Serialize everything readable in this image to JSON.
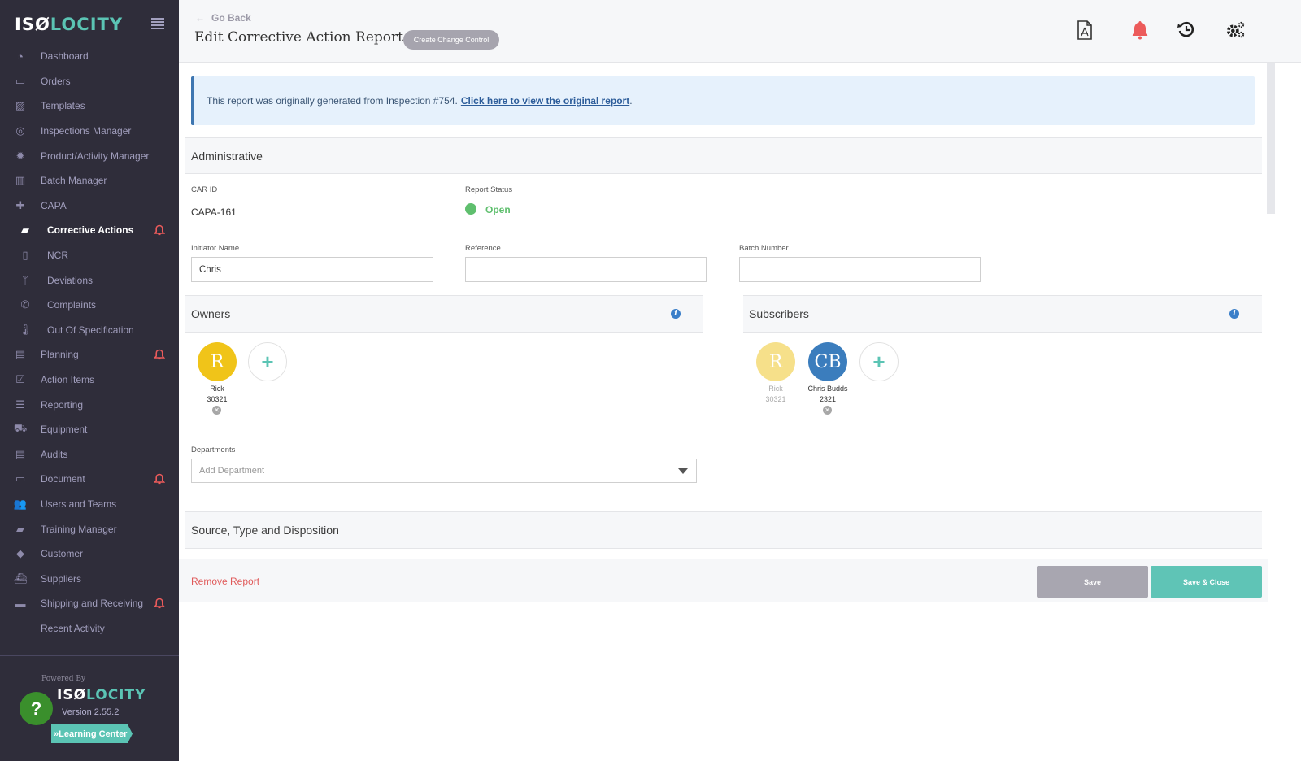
{
  "sidebar": {
    "logo_white": "ISØ",
    "logo_teal": "LOCITY",
    "items": [
      {
        "label": "Dashboard",
        "icon": "dashboard-icon",
        "glyph": "◔",
        "sub": false,
        "active": false,
        "bell": false
      },
      {
        "label": "Orders",
        "icon": "inbox-icon",
        "glyph": "▭",
        "sub": false,
        "active": false,
        "bell": false
      },
      {
        "label": "Templates",
        "icon": "image-icon",
        "glyph": "▨",
        "sub": false,
        "active": false,
        "bell": false
      },
      {
        "label": "Inspections Manager",
        "icon": "target-icon",
        "glyph": "◎",
        "sub": false,
        "active": false,
        "bell": false
      },
      {
        "label": "Product/Activity Manager",
        "icon": "gear-icon",
        "glyph": "✹",
        "sub": false,
        "active": false,
        "bell": false
      },
      {
        "label": "Batch Manager",
        "icon": "barcode-icon",
        "glyph": "▥",
        "sub": false,
        "active": false,
        "bell": false
      },
      {
        "label": "CAPA",
        "icon": "medkit-icon",
        "glyph": "✚",
        "sub": false,
        "active": false,
        "bell": false
      },
      {
        "label": "Corrective Actions",
        "icon": "book-icon",
        "glyph": "▰",
        "sub": true,
        "active": true,
        "bell": true
      },
      {
        "label": "NCR",
        "icon": "file-icon",
        "glyph": "▯",
        "sub": true,
        "active": false,
        "bell": false
      },
      {
        "label": "Deviations",
        "icon": "branch-icon",
        "glyph": "ᛘ",
        "sub": true,
        "active": false,
        "bell": false
      },
      {
        "label": "Complaints",
        "icon": "phone-icon",
        "glyph": "✆",
        "sub": true,
        "active": false,
        "bell": false
      },
      {
        "label": "Out Of Specification",
        "icon": "thermometer-icon",
        "glyph": "🌡",
        "sub": true,
        "active": false,
        "bell": false
      },
      {
        "label": "Planning",
        "icon": "map-icon",
        "glyph": "▤",
        "sub": false,
        "active": false,
        "bell": true
      },
      {
        "label": "Action Items",
        "icon": "checkbox-icon",
        "glyph": "☑",
        "sub": false,
        "active": false,
        "bell": false
      },
      {
        "label": "Reporting",
        "icon": "report-icon",
        "glyph": "☰",
        "sub": false,
        "active": false,
        "bell": false
      },
      {
        "label": "Equipment",
        "icon": "truck-icon",
        "glyph": "⛟",
        "sub": false,
        "active": false,
        "bell": false
      },
      {
        "label": "Audits",
        "icon": "document-icon",
        "glyph": "▤",
        "sub": false,
        "active": false,
        "bell": false
      },
      {
        "label": "Document",
        "icon": "folder-icon",
        "glyph": "▭",
        "sub": false,
        "active": false,
        "bell": true
      },
      {
        "label": "Users and Teams",
        "icon": "users-icon",
        "glyph": "👥",
        "sub": false,
        "active": false,
        "bell": false
      },
      {
        "label": "Training Manager",
        "icon": "book-icon",
        "glyph": "▰",
        "sub": false,
        "active": false,
        "bell": false
      },
      {
        "label": "Customer",
        "icon": "tag-icon",
        "glyph": "◆",
        "sub": false,
        "active": false,
        "bell": false
      },
      {
        "label": "Suppliers",
        "icon": "ship-icon",
        "glyph": "⛴",
        "sub": false,
        "active": false,
        "bell": false
      },
      {
        "label": "Shipping and Receiving",
        "icon": "tray-icon",
        "glyph": "▬",
        "sub": false,
        "active": false,
        "bell": true
      },
      {
        "label": "Recent Activity",
        "icon": "",
        "glyph": "",
        "sub": false,
        "active": false,
        "bell": false
      }
    ],
    "powered_by": "Powered By",
    "version": "Version 2.55.2",
    "help": "?",
    "learning_center": "»Learning Center"
  },
  "header": {
    "go_back": "Go Back",
    "title": "Edit Corrective Action Report",
    "change_control": "Create Change Control"
  },
  "banner": {
    "text": "This report was originally generated from Inspection #754.",
    "link": "Click here to view the original report",
    "suffix": "."
  },
  "administrative": {
    "heading": "Administrative",
    "car_id_label": "CAR ID",
    "car_id": "CAPA-161",
    "status_label": "Report Status",
    "status": "Open",
    "status_color": "#5fbf6e",
    "initiator_label": "Initiator Name",
    "initiator": "Chris",
    "reference_label": "Reference",
    "reference": "",
    "batch_label": "Batch Number",
    "batch": ""
  },
  "owners": {
    "heading": "Owners",
    "people": [
      {
        "initials": "R",
        "name": "Rick",
        "id": "30321",
        "color": "#f0c419"
      }
    ]
  },
  "subscribers": {
    "heading": "Subscribers",
    "people": [
      {
        "initials": "R",
        "name": "Rick",
        "id": "30321",
        "color": "#f6e08a"
      },
      {
        "initials": "CB",
        "name": "Chris Budds",
        "id": "2321",
        "color": "#3b7dbd"
      }
    ]
  },
  "departments": {
    "label": "Departments",
    "placeholder": "Add Department"
  },
  "source_section": {
    "heading": "Source, Type and Disposition"
  },
  "footer": {
    "remove": "Remove Report",
    "save": "Save",
    "save_close": "Save & Close"
  }
}
